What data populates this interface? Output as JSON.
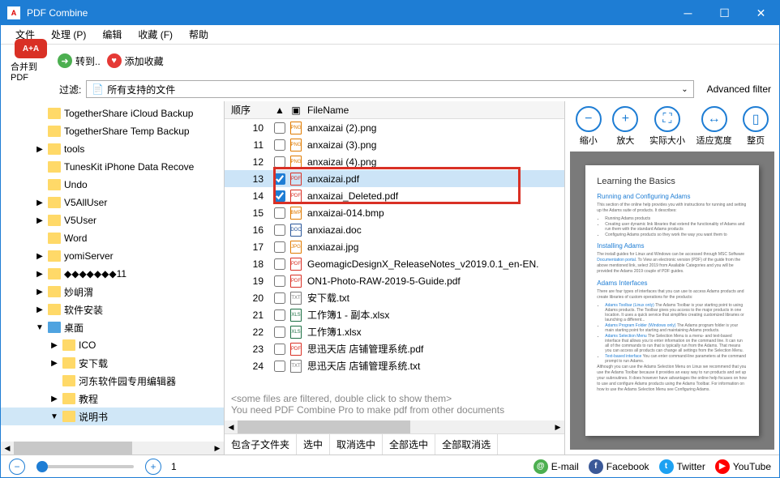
{
  "window": {
    "title": "PDF Combine"
  },
  "menu": {
    "items": [
      "文件",
      "处理 (P)",
      "编辑",
      "收藏 (F)",
      "帮助"
    ]
  },
  "toolbar": {
    "main_label": "合并到 PDF",
    "goto_label": "转到..",
    "fav_label": "添加收藏"
  },
  "filter": {
    "label": "过滤:",
    "value": "所有支持的文件",
    "advanced": "Advanced filter"
  },
  "tree": {
    "items": [
      {
        "level": 2,
        "caret": "",
        "icon": "folder-yellow",
        "label": "TogetherShare iCloud Backup"
      },
      {
        "level": 2,
        "caret": "",
        "icon": "folder-yellow",
        "label": "TogetherShare Temp Backup"
      },
      {
        "level": 2,
        "caret": "▶",
        "icon": "folder-yellow",
        "label": "tools"
      },
      {
        "level": 2,
        "caret": "",
        "icon": "folder-yellow",
        "label": "TunesKit iPhone Data Recove"
      },
      {
        "level": 2,
        "caret": "",
        "icon": "folder-yellow",
        "label": "Undo"
      },
      {
        "level": 2,
        "caret": "▶",
        "icon": "folder-yellow",
        "label": "V5AllUser"
      },
      {
        "level": 2,
        "caret": "▶",
        "icon": "folder-yellow",
        "label": "V5User"
      },
      {
        "level": 2,
        "caret": "",
        "icon": "folder-yellow",
        "label": "Word"
      },
      {
        "level": 2,
        "caret": "▶",
        "icon": "folder-yellow",
        "label": "yomiServer"
      },
      {
        "level": 2,
        "caret": "▶",
        "icon": "folder-yellow",
        "label": "◆◆◆◆◆◆◆11"
      },
      {
        "level": 2,
        "caret": "▶",
        "icon": "folder-yellow",
        "label": "妙岄渭"
      },
      {
        "level": 2,
        "caret": "▶",
        "icon": "folder-yellow",
        "label": "软件安装"
      },
      {
        "level": 2,
        "caret": "▼",
        "icon": "folder-blue",
        "label": "桌面"
      },
      {
        "level": 3,
        "caret": "▶",
        "icon": "folder-yellow",
        "label": "ICO"
      },
      {
        "level": 3,
        "caret": "▶",
        "icon": "folder-yellow",
        "label": "安下载"
      },
      {
        "level": 3,
        "caret": "",
        "icon": "folder-yellow",
        "label": "河东软件园专用编辑器"
      },
      {
        "level": 3,
        "caret": "▶",
        "icon": "folder-yellow",
        "label": "教程"
      },
      {
        "level": 3,
        "caret": "▼",
        "icon": "folder-yellow",
        "label": "说明书",
        "selected": true
      }
    ]
  },
  "filelist": {
    "header": {
      "col1": "顺序",
      "col4": "FileName"
    },
    "rows": [
      {
        "num": 10,
        "checked": false,
        "type": "png",
        "name": "anxaizai (2).png"
      },
      {
        "num": 11,
        "checked": false,
        "type": "png",
        "name": "anxaizai (3).png"
      },
      {
        "num": 12,
        "checked": false,
        "type": "png",
        "name": "anxaizai (4).png"
      },
      {
        "num": 13,
        "checked": true,
        "type": "pdf",
        "name": "anxaizai.pdf",
        "selected": true
      },
      {
        "num": 14,
        "checked": true,
        "type": "pdf",
        "name": "anxaizai_Deleted.pdf"
      },
      {
        "num": 15,
        "checked": false,
        "type": "bmp",
        "name": "anxaizai-014.bmp"
      },
      {
        "num": 16,
        "checked": false,
        "type": "doc",
        "name": "anxiazai.doc"
      },
      {
        "num": 17,
        "checked": false,
        "type": "jpg",
        "name": "anxiazai.jpg"
      },
      {
        "num": 18,
        "checked": false,
        "type": "pdf",
        "name": "GeomagicDesignX_ReleaseNotes_v2019.0.1_en-EN."
      },
      {
        "num": 19,
        "checked": false,
        "type": "pdf",
        "name": "ON1-Photo-RAW-2019-5-Guide.pdf"
      },
      {
        "num": 20,
        "checked": false,
        "type": "txt",
        "name": "安下载.txt"
      },
      {
        "num": 21,
        "checked": false,
        "type": "xlsx",
        "name": "工作簿1 - 副本.xlsx"
      },
      {
        "num": 22,
        "checked": false,
        "type": "xlsx",
        "name": "工作簿1.xlsx"
      },
      {
        "num": 23,
        "checked": false,
        "type": "pdf",
        "name": "思迅天店 店铺管理系统.pdf"
      },
      {
        "num": 24,
        "checked": false,
        "type": "txt",
        "name": "思迅天店 店铺管理系统.txt"
      }
    ],
    "hint1": "<some files are filtered, double click to show them>",
    "hint2": "You need PDF Combine Pro to make pdf from other documents",
    "footer": [
      "包含子文件夹",
      "选中",
      "取消选中",
      "全部选中",
      "全部取消选"
    ]
  },
  "preview": {
    "buttons": [
      "缩小",
      "放大",
      "实际大小",
      "适应宽度",
      "整页"
    ],
    "doc": {
      "title": "Learning the Basics",
      "sub1": "Running and Configuring Adams",
      "sub2": "Adams Interfaces",
      "sub3": "Installing Adams"
    }
  },
  "statusbar": {
    "page": "1",
    "social": {
      "email": "E-mail",
      "fb": "Facebook",
      "tw": "Twitter",
      "yt": "YouTube"
    }
  }
}
